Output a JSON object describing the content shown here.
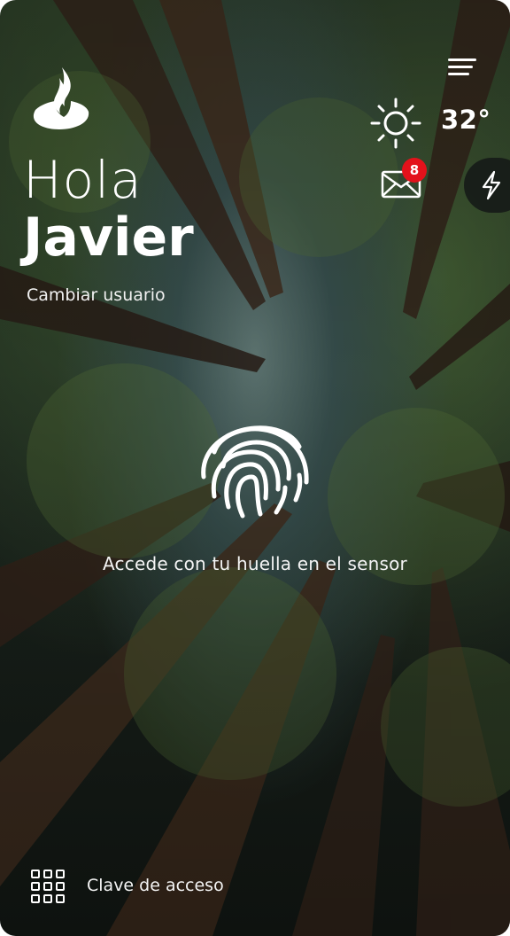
{
  "header": {
    "logo_icon": "santander-flame-icon",
    "menu_icon": "hamburger-menu-icon",
    "weather": {
      "icon": "sun-icon",
      "temperature": "32°"
    },
    "messages": {
      "icon": "envelope-icon",
      "unread_count": "8"
    },
    "quick_action_icon": "lightning-icon"
  },
  "greeting": {
    "line1": "Hola",
    "name": "Javier",
    "change_user": "Cambiar usuario"
  },
  "login": {
    "fingerprint_icon": "fingerprint-icon",
    "instruction": "Accede con tu huella en el sensor"
  },
  "footer": {
    "keypad_icon": "keypad-icon",
    "access_key_label": "Clave de acceso"
  },
  "colors": {
    "badge": "#e3121b",
    "text": "#ffffff"
  }
}
